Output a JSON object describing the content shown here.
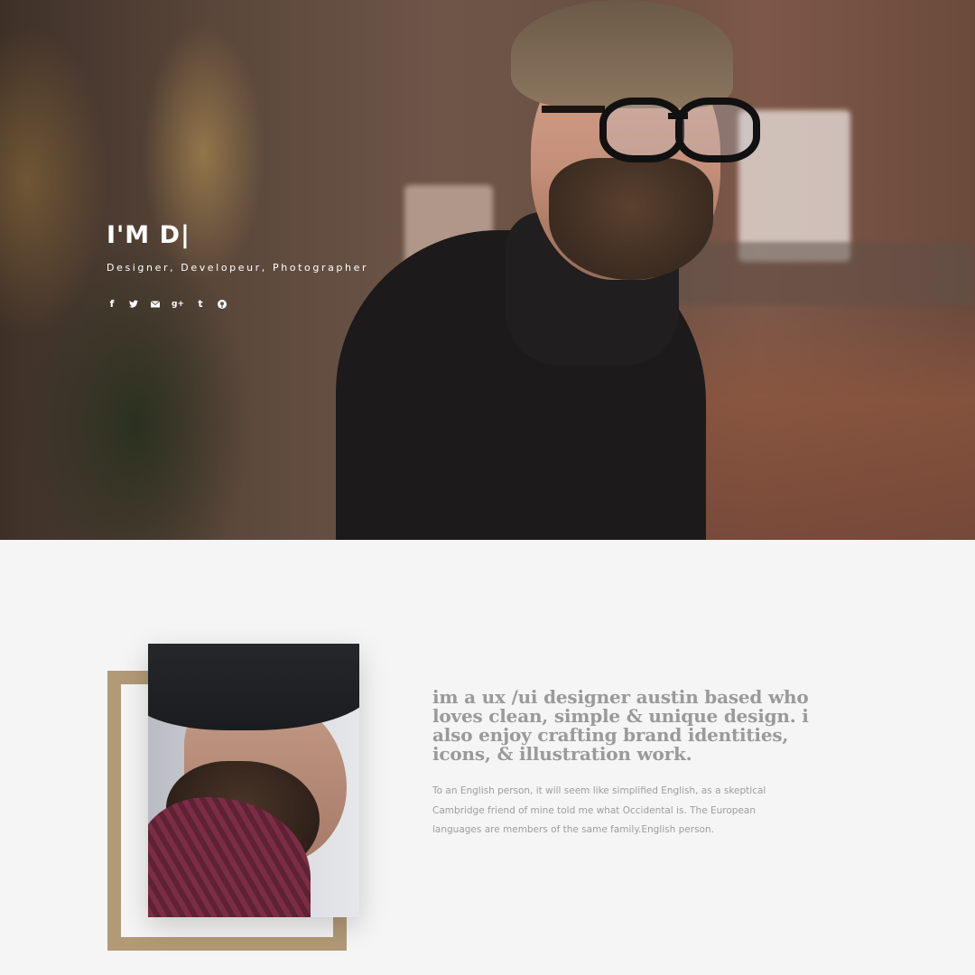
{
  "hero": {
    "title": "I'M D|",
    "subtitle": "Designer, Developeur, Photographer",
    "social": [
      {
        "icon": "facebook-icon",
        "glyph": "f"
      },
      {
        "icon": "twitter-icon",
        "glyph": "🐦"
      },
      {
        "icon": "email-icon",
        "glyph": "✉"
      },
      {
        "icon": "google-plus-icon",
        "glyph": "g+"
      },
      {
        "icon": "tumblr-icon",
        "glyph": "t"
      },
      {
        "icon": "pinterest-icon",
        "glyph": "℗"
      }
    ]
  },
  "about": {
    "heading": "im a ux /ui designer austin based who loves clean, simple & unique design. i also enjoy crafting brand identities, icons, & illustration work.",
    "paragraph": "To an English person, it will seem like simplified English, as a skeptical Cambridge friend of mine told me what Occidental is. The European languages are members of the same family.English person."
  },
  "colors": {
    "accent_frame": "#b29a76",
    "heading_text": "#9a9a9a",
    "background": "#f5f5f5"
  }
}
